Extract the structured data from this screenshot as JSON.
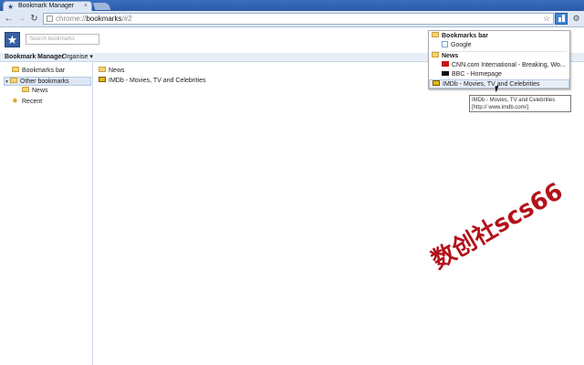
{
  "tab": {
    "title": "Bookmark Manager",
    "close": "×"
  },
  "toolbar": {
    "back": "←",
    "forward": "→",
    "reload": "↻",
    "url_scheme": "chrome://",
    "url_host": "bookmarks",
    "url_path": "/#2",
    "star": "☆",
    "wrench": "🔧"
  },
  "manager": {
    "logo": "★",
    "search_placeholder": "Search bookmarks",
    "title": "Bookmark Manager",
    "organise": "Organise ▾"
  },
  "tree": {
    "items": [
      {
        "label": "Bookmarks bar"
      },
      {
        "label": "Other bookmarks"
      },
      {
        "label": "News"
      },
      {
        "label": "Recent"
      }
    ]
  },
  "list": {
    "items": [
      {
        "label": "News"
      },
      {
        "label": "IMDb - Movies, TV and Celebrities"
      }
    ]
  },
  "popup": {
    "bookmarks_bar": "Bookmarks bar",
    "google": "Google",
    "news": "News",
    "cnn": "CNN.com International - Breaking, Wo...",
    "bbc": "BBC - Homepage",
    "imdb": "IMDb - Movies, TV and Celebrities"
  },
  "tooltip": {
    "text": "IMDb - Movies, TV and Celebrities [http:// www.imdb.com/]"
  },
  "watermark": {
    "text": "数创社scs66"
  },
  "colors": {
    "accent": "#3860a6",
    "folder": "#f3d27a",
    "watermark": "#b3121a"
  }
}
